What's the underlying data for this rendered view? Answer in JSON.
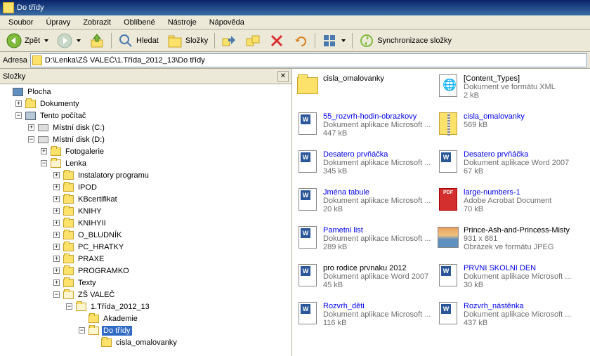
{
  "window": {
    "title": "Do třídy"
  },
  "menu": [
    "Soubor",
    "Úpravy",
    "Zobrazit",
    "Oblíbené",
    "Nástroje",
    "Nápověda"
  ],
  "toolbar": {
    "back": "Zpět",
    "search": "Hledat",
    "folders": "Složky",
    "sync": "Synchronizace složky"
  },
  "address": {
    "label": "Adresa",
    "path": "D:\\Lenka\\ZŠ VALEČ\\1.Třída_2012_13\\Do třídy"
  },
  "sidebar": {
    "title": "Složky"
  },
  "tree": [
    {
      "d": 0,
      "e": "",
      "i": "desktop",
      "t": "Plocha"
    },
    {
      "d": 1,
      "e": "+",
      "i": "folder",
      "t": "Dokumenty"
    },
    {
      "d": 1,
      "e": "-",
      "i": "comp",
      "t": "Tento počítač"
    },
    {
      "d": 2,
      "e": "+",
      "i": "drive",
      "t": "Místní disk (C:)"
    },
    {
      "d": 2,
      "e": "-",
      "i": "drive",
      "t": "Místní disk (D:)"
    },
    {
      "d": 3,
      "e": "+",
      "i": "folder",
      "t": "Fotogalerie"
    },
    {
      "d": 3,
      "e": "-",
      "i": "folder-open",
      "t": "Lenka"
    },
    {
      "d": 4,
      "e": "+",
      "i": "folder",
      "t": "Instalatory programu"
    },
    {
      "d": 4,
      "e": "+",
      "i": "folder",
      "t": "IPOD"
    },
    {
      "d": 4,
      "e": "+",
      "i": "folder",
      "t": "KBcertifikat"
    },
    {
      "d": 4,
      "e": "+",
      "i": "folder",
      "t": "KNIHY"
    },
    {
      "d": 4,
      "e": "+",
      "i": "folder",
      "t": "KNIHYII"
    },
    {
      "d": 4,
      "e": "+",
      "i": "folder",
      "t": "O_BLUDNÍK"
    },
    {
      "d": 4,
      "e": "+",
      "i": "folder",
      "t": "PC_HRATKY"
    },
    {
      "d": 4,
      "e": "+",
      "i": "folder",
      "t": "PRAXE"
    },
    {
      "d": 4,
      "e": "+",
      "i": "folder",
      "t": "PROGRAMKO"
    },
    {
      "d": 4,
      "e": "+",
      "i": "folder",
      "t": "Texty"
    },
    {
      "d": 4,
      "e": "-",
      "i": "folder-open",
      "t": "ZŠ VALEČ"
    },
    {
      "d": 5,
      "e": "-",
      "i": "folder-open",
      "t": "1.Třída_2012_13"
    },
    {
      "d": 6,
      "e": "",
      "i": "folder",
      "t": "Akademie"
    },
    {
      "d": 6,
      "e": "-",
      "i": "folder-open",
      "t": "Do třídy",
      "sel": true
    },
    {
      "d": 7,
      "e": "",
      "i": "folder",
      "t": "cisla_omalovanky"
    }
  ],
  "files": [
    {
      "icon": "folder",
      "name": "cisla_omalovanky",
      "nolink": true,
      "desc": "",
      "size": ""
    },
    {
      "icon": "xml",
      "name": "[Content_Types]",
      "nolink": true,
      "desc": "Dokument ve formátu XML",
      "size": "2 kB"
    },
    {
      "icon": "word",
      "name": "55_rozvrh-hodin-obrazkovy",
      "desc": "Dokument aplikace Microsoft ...",
      "size": "447 kB"
    },
    {
      "icon": "zip",
      "name": "cisla_omalovanky",
      "desc": "",
      "size": "569 kB"
    },
    {
      "icon": "word",
      "name": "Desatero prvňáčka",
      "desc": "Dokument aplikace Microsoft ...",
      "size": "345 kB"
    },
    {
      "icon": "word",
      "name": "Desatero prvňáčka",
      "desc": "Dokument aplikace Word 2007",
      "size": "67 kB"
    },
    {
      "icon": "word",
      "name": "Jména tabule",
      "desc": "Dokument aplikace Microsoft ...",
      "size": "20 kB"
    },
    {
      "icon": "pdf",
      "name": "large-numbers-1",
      "desc": "Adobe Acrobat Document",
      "size": "70 kB"
    },
    {
      "icon": "word",
      "name": "Pametni list",
      "desc": "Dokument aplikace Microsoft ...",
      "size": "289 kB"
    },
    {
      "icon": "img",
      "name": "Prince-Ash-and-Princess-Misty",
      "nolink": true,
      "desc": "931 x 861",
      "size": "Obrázek ve formátu JPEG"
    },
    {
      "icon": "word",
      "name": "pro rodice prvnaku 2012",
      "nolink": true,
      "desc": "Dokument aplikace Word 2007",
      "size": "45 kB"
    },
    {
      "icon": "word",
      "name": "PRVNI SKOLNI DEN",
      "desc": "Dokument aplikace Microsoft ...",
      "size": "30 kB"
    },
    {
      "icon": "word",
      "name": "Rozvrh_děti",
      "desc": "Dokument aplikace Microsoft ...",
      "size": "116 kB"
    },
    {
      "icon": "word",
      "name": "Rozvrh_nástěnka",
      "desc": "Dokument aplikace Microsoft ...",
      "size": "437 kB"
    }
  ]
}
